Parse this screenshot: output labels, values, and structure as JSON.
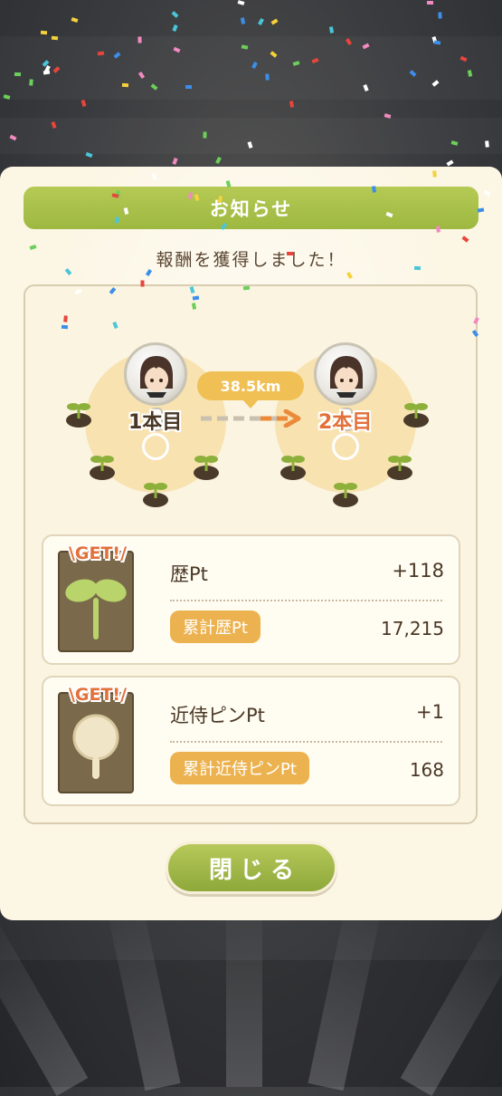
{
  "dialog": {
    "title": "お知らせ",
    "subtitle": "報酬を獲得しました！"
  },
  "progress": {
    "distance": "38.5km",
    "from_label": "1本目",
    "to_label": "2本目"
  },
  "rewards": [
    {
      "badge": "\\GET!/",
      "name": "歴Pt",
      "gain": "+118",
      "total_label": "累計歴Pt",
      "total_value": "17,215",
      "icon": "sprout-icon"
    },
    {
      "badge": "\\GET!/",
      "name": "近侍ピンPt",
      "gain": "+1",
      "total_label": "累計近侍ピンPt",
      "total_value": "168",
      "icon": "pin-icon"
    }
  ],
  "close_button": "閉じる",
  "colors": {
    "header_green": "#a8bf4b",
    "accent_orange": "#e2703a",
    "pill_yellow": "#ecb24f",
    "modal_bg": "#fcf6e5"
  }
}
